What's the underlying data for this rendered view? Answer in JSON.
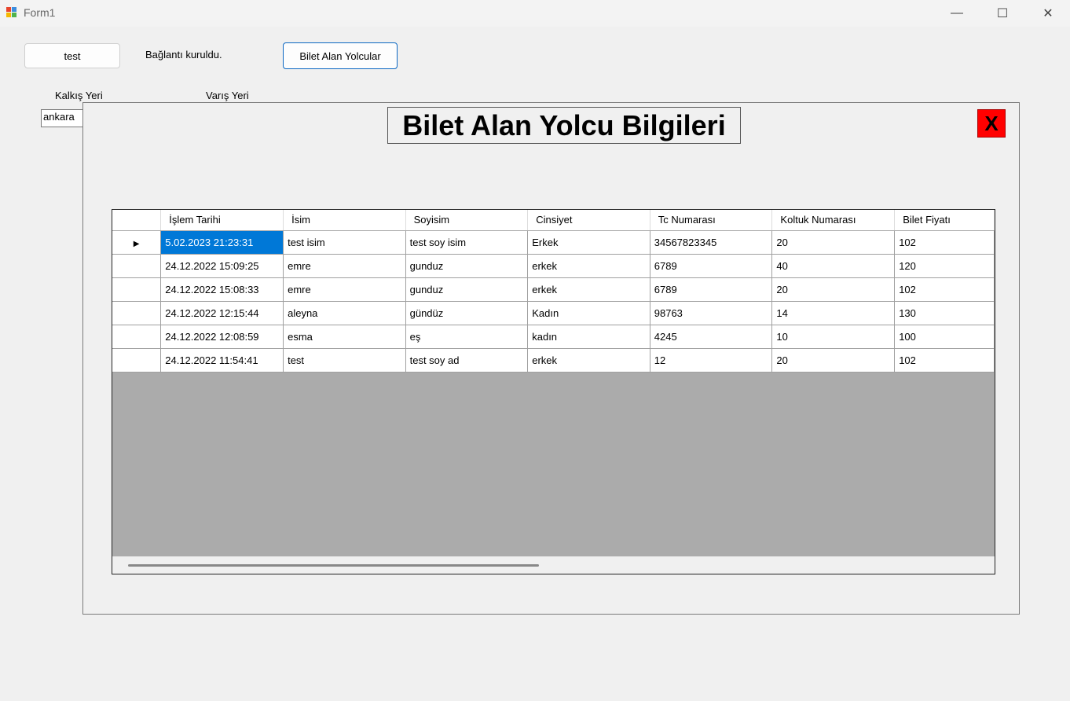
{
  "window": {
    "title": "Form1"
  },
  "top": {
    "test_button": "test",
    "status_label": "Bağlantı kuruldu.",
    "passengers_button": "Bilet Alan Yolcular"
  },
  "form": {
    "departure_label": "Kalkış Yeri",
    "arrival_label": "Varış Yeri",
    "departure_value": "ankara"
  },
  "panel": {
    "title": "Bilet Alan Yolcu Bilgileri",
    "close_label": "X"
  },
  "grid": {
    "columns": [
      "İşlem Tarihi",
      "İsim",
      "Soyisim",
      "Cinsiyet",
      "Tc Numarası",
      "Koltuk Numarası",
      "Bilet Fiyatı"
    ],
    "rows": [
      [
        "5.02.2023 21:23:31",
        "test isim",
        "test soy isim",
        "Erkek",
        "34567823345",
        "20",
        "102"
      ],
      [
        "24.12.2022 15:09:25",
        "emre",
        "gunduz",
        "erkek",
        "6789",
        "40",
        "120"
      ],
      [
        "24.12.2022 15:08:33",
        "emre",
        "gunduz",
        "erkek",
        "6789",
        "20",
        "102"
      ],
      [
        "24.12.2022 12:15:44",
        "aleyna",
        "gündüz",
        "Kadın",
        "98763",
        "14",
        "130"
      ],
      [
        "24.12.2022 12:08:59",
        "esma",
        "eş",
        "kadın",
        "4245",
        "10",
        "100"
      ],
      [
        "24.12.2022 11:54:41",
        "test",
        "test soy ad",
        "erkek",
        "12",
        "20",
        "102"
      ]
    ],
    "selected_row": 0,
    "row_indicator_icon": "triangle-right-icon"
  },
  "colors": {
    "selection": "#0078d7",
    "close_button": "#ff0000",
    "grid_background": "#ababab"
  }
}
